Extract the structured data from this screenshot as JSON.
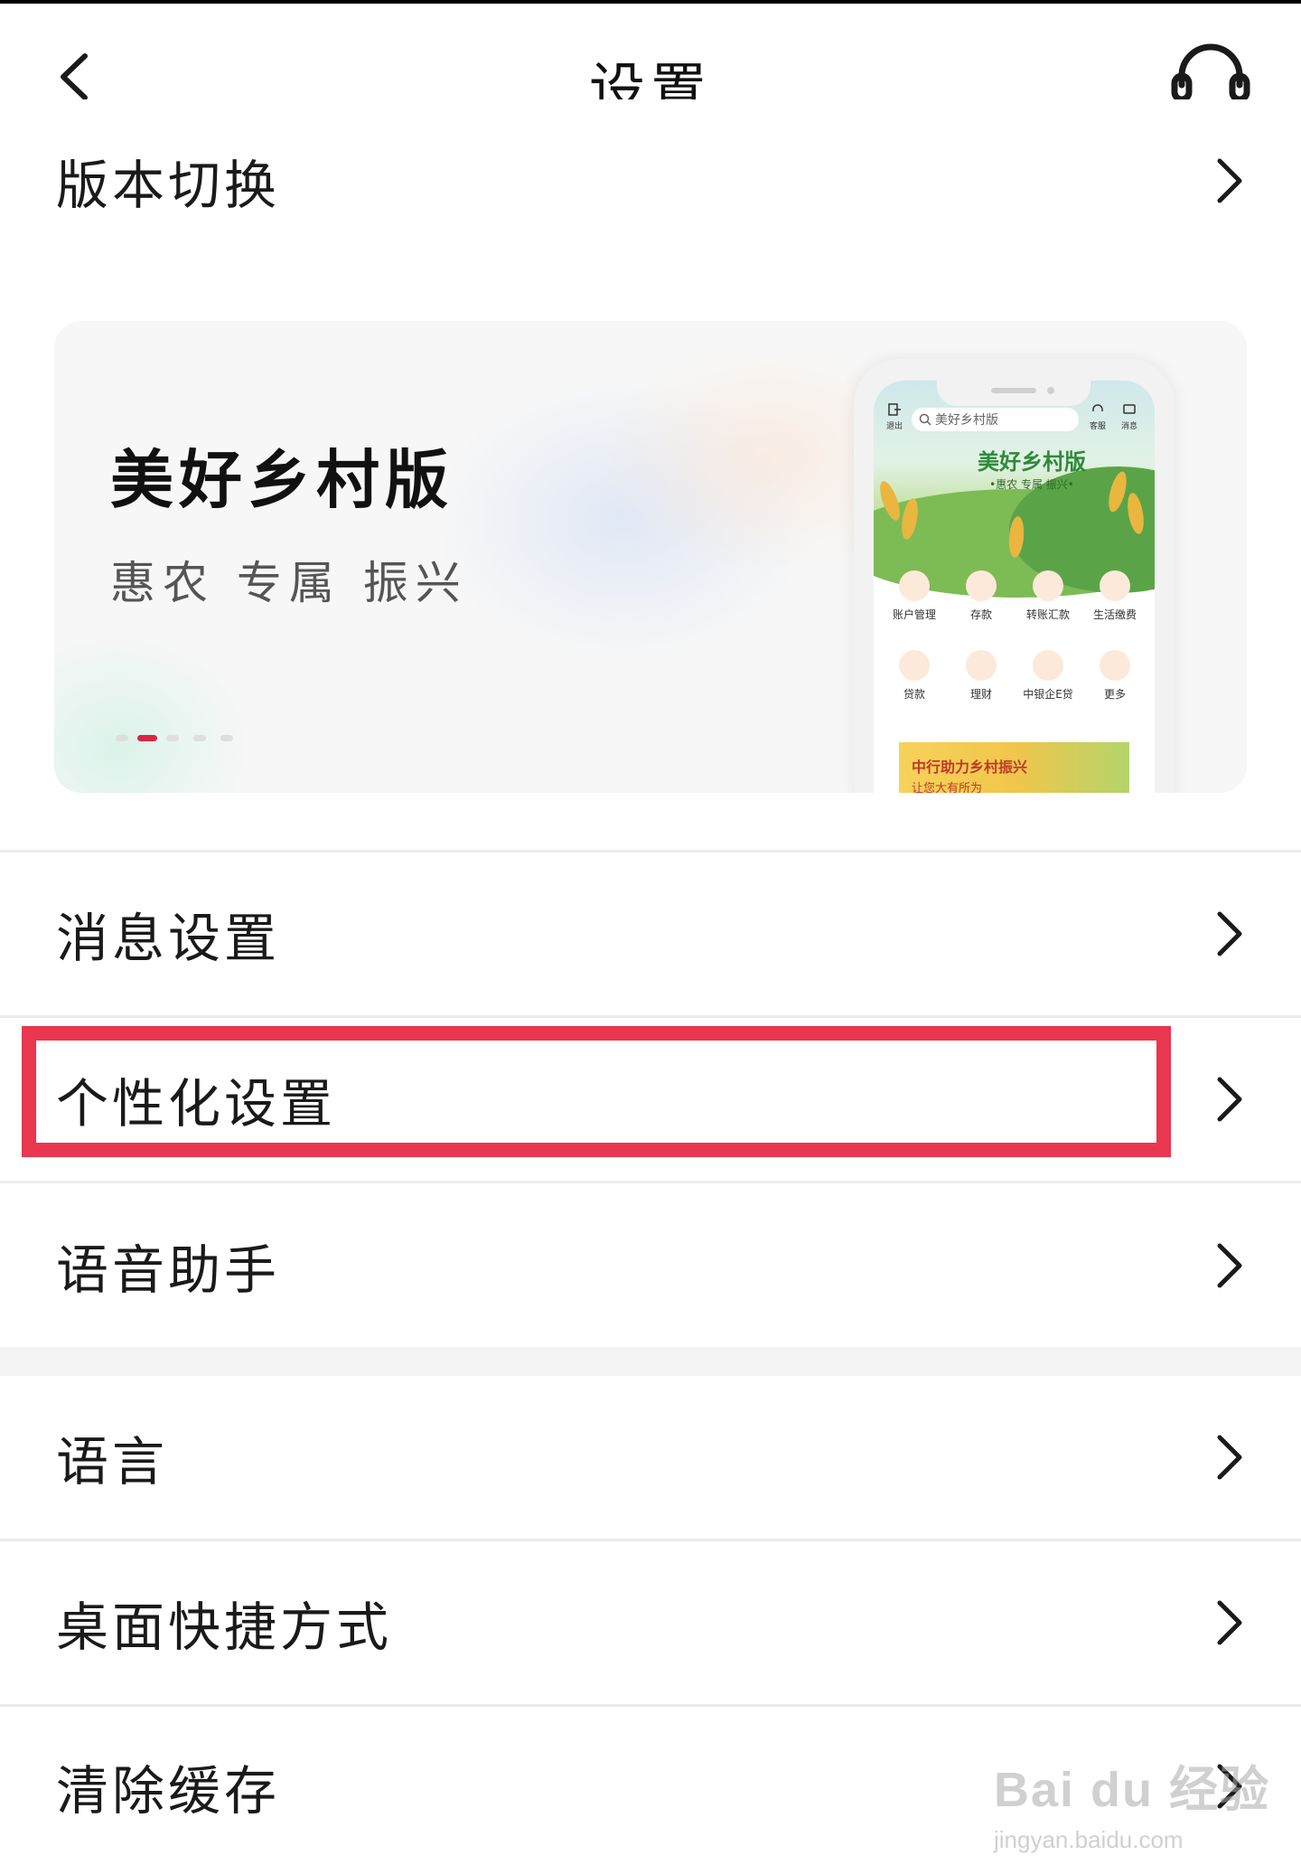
{
  "header": {
    "title": "设置",
    "back_icon": "chevron-left-icon",
    "support_icon": "headset-icon"
  },
  "rows": {
    "version_switch": "版本切换",
    "message_settings": "消息设置",
    "personalization": "个性化设置",
    "voice_assistant": "语音助手",
    "language": "语言",
    "desktop_shortcut": "桌面快捷方式",
    "clear_cache": "清除缓存"
  },
  "banner": {
    "title": "美好乡村版",
    "subtitle": "惠农 专属 振兴",
    "carousel_total": 5,
    "carousel_active_index": 2,
    "preview": {
      "search_placeholder": "美好乡村版",
      "top_left_label": "退出",
      "top_right_labels": [
        "客服",
        "消息"
      ],
      "brand": "美好乡村版",
      "slogan": "•惠农 专属 振兴•",
      "grid": [
        {
          "label": "账户管理",
          "icon": "card-icon"
        },
        {
          "label": "存款",
          "icon": "piggy-icon"
        },
        {
          "label": "转账汇款",
          "icon": "transfer-icon"
        },
        {
          "label": "生活缴费",
          "icon": "bolt-icon"
        },
        {
          "label": "贷款",
          "icon": "loan-icon"
        },
        {
          "label": "理财",
          "icon": "coin-icon"
        },
        {
          "label": "中银企E贷",
          "icon": "hand-icon"
        },
        {
          "label": "更多",
          "icon": "grid-icon"
        }
      ],
      "promo_line1": "中行助力乡村振兴",
      "promo_line2": "让您大有所为"
    }
  },
  "highlight": {
    "target": "个性化设置",
    "color": "#e8374f"
  },
  "colors": {
    "accent": "#d9263f",
    "divider": "#ececec",
    "section_gap": "#f3f3f3"
  },
  "watermark": {
    "main": "Bai du 经验",
    "sub": "jingyan.baidu.com"
  }
}
